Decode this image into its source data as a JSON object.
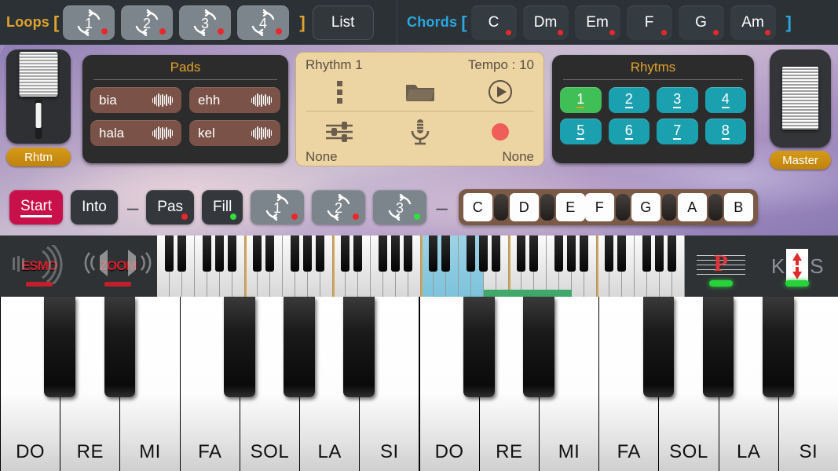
{
  "topbar": {
    "loops_label": "Loops",
    "bracket_open": "[",
    "bracket_close": "]",
    "loops": [
      {
        "num": "1",
        "led": "#e8282a"
      },
      {
        "num": "2",
        "led": "#e8282a"
      },
      {
        "num": "3",
        "led": "#e8282a"
      },
      {
        "num": "4",
        "led": "#e8282a"
      }
    ],
    "list_label": "List",
    "chords_label": "Chords",
    "chords": [
      {
        "label": "C",
        "led": "#e8282a"
      },
      {
        "label": "Dm",
        "led": "#e8282a"
      },
      {
        "label": "Em",
        "led": "#e8282a"
      },
      {
        "label": "F",
        "led": "#e8282a"
      },
      {
        "label": "G",
        "led": "#e8282a"
      },
      {
        "label": "Am",
        "led": "#e8282a"
      }
    ]
  },
  "left_fader": {
    "label": "Rhtm"
  },
  "pads": {
    "title": "Pads",
    "items": [
      {
        "label": "bia"
      },
      {
        "label": "ehh"
      },
      {
        "label": "hala"
      },
      {
        "label": "kel"
      }
    ]
  },
  "rhythm_panel": {
    "name": "Rhythm 1",
    "tempo": "Tempo : 10",
    "bottom_left": "None",
    "bottom_right": "None",
    "icons": [
      "more-vertical-icon",
      "folder-icon",
      "play-icon",
      "mixer-icon",
      "microphone-icon",
      "record-icon"
    ]
  },
  "rhytms": {
    "title": "Rhytms",
    "buttons": [
      {
        "label": "1",
        "active": true
      },
      {
        "label": "2",
        "active": false
      },
      {
        "label": "3",
        "active": false
      },
      {
        "label": "4",
        "active": false
      },
      {
        "label": "5",
        "active": false
      },
      {
        "label": "6",
        "active": false
      },
      {
        "label": "7",
        "active": false
      },
      {
        "label": "8",
        "active": false
      }
    ],
    "active_color": "#3fbf56",
    "idle_color": "#1ba0b0"
  },
  "master_fader": {
    "label": "Master"
  },
  "transport": {
    "start": "Start",
    "into": "Into",
    "pas": "Pas",
    "fill": "Fill",
    "dash": "–",
    "loop_buttons": [
      {
        "num": "1",
        "led": "red"
      },
      {
        "num": "2",
        "led": "red"
      },
      {
        "num": "3",
        "led": "green"
      }
    ],
    "pas_led": "red",
    "fill_led": "green",
    "chord_keys": [
      "C",
      "D",
      "E",
      "F",
      "G",
      "A",
      "B"
    ]
  },
  "strip": {
    "logo_left": "ESMO",
    "logo_right": "ZOOM",
    "staff_letter": "P",
    "ks_left": "K",
    "ks_right": "S",
    "arrow_icon": "up-down-arrow-icon"
  },
  "piano": {
    "key_labels": [
      "DO",
      "RE",
      "MI",
      "FA",
      "SOL",
      "LA",
      "SI",
      "DO",
      "RE",
      "MI",
      "FA",
      "SOL",
      "LA",
      "SI"
    ],
    "menu_icon": "settings-icon"
  }
}
